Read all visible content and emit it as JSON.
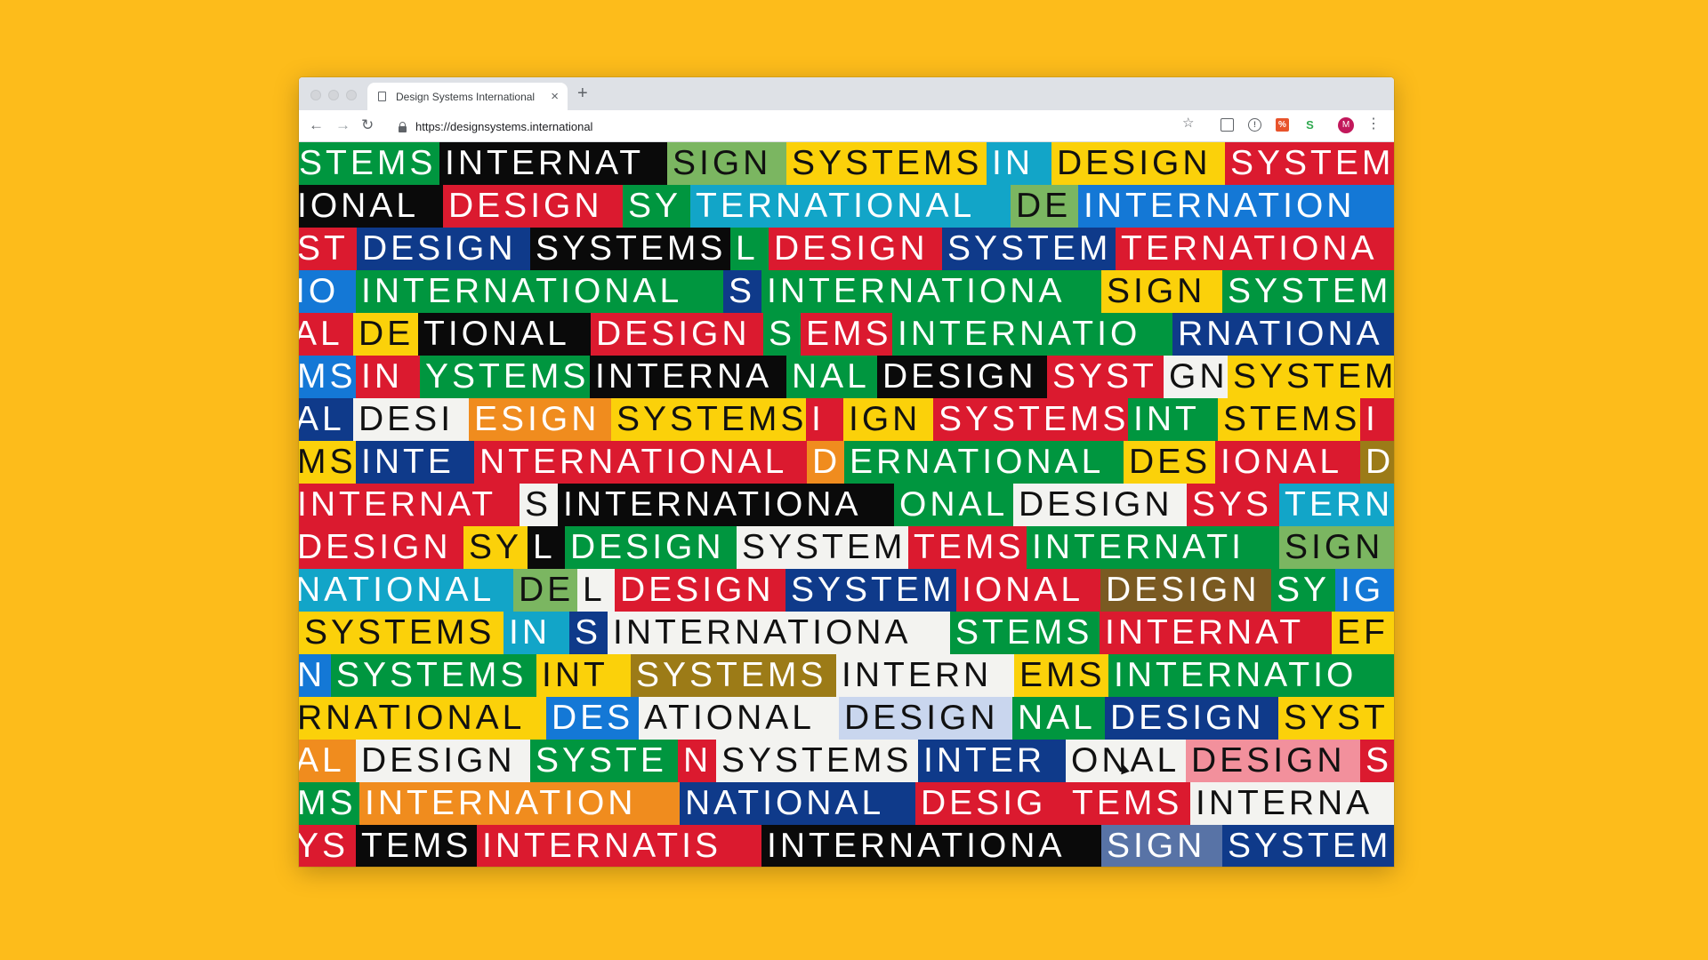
{
  "browser": {
    "tab_title": "Design Systems International",
    "tab_close_glyph": "×",
    "new_tab_glyph": "+",
    "back_glyph": "←",
    "forward_glyph": "→",
    "reload_glyph": "↻",
    "url": "https://designsystems.international",
    "star_glyph": "☆",
    "ext_shield_glyph": "!",
    "ext_pct_glyph": "%",
    "ext_s_glyph": "S",
    "avatar_initial": "M",
    "menu_glyph": "⋮",
    "icons": [
      "page-icon",
      "close-icon",
      "plus-icon",
      "back-arrow-icon",
      "forward-arrow-icon",
      "reload-icon",
      "lock-icon",
      "star-icon",
      "mail-extension-icon",
      "shield-extension-icon",
      "percent-extension-icon",
      "s-extension-icon",
      "avatar",
      "kebab-menu-icon"
    ]
  },
  "colors": {
    "page_background": "#FDBC1B",
    "red": "#DB1A2F",
    "black": "#0A0A0A",
    "lightgreen": "#7BB661",
    "yellow": "#FBD10A",
    "teal": "#12A5C8",
    "navy": "#0F3A8A",
    "green": "#00963F",
    "blue": "#1478D6",
    "white": "#F3F3F0",
    "orange": "#F08C1E",
    "gold": "#9C7B17",
    "brown": "#7A5A22",
    "pink": "#F2909C",
    "lightblue": "#C9D6EE",
    "slate": "#5873A6"
  },
  "content": {
    "rows": [
      [
        {
          "t": "STEMS",
          "c": "green"
        },
        {
          "t": "INTERNAT",
          "c": "black"
        },
        {
          "t": "SIGN",
          "c": "lightgreen"
        },
        {
          "t": "SYSTEMS",
          "c": "yellow"
        },
        {
          "t": "IN",
          "c": "teal"
        },
        {
          "t": "DESIGN",
          "c": "yellow"
        },
        {
          "t": "SYSTEM",
          "c": "red"
        }
      ],
      [
        {
          "t": "IONAL",
          "c": "black"
        },
        {
          "t": "DESIGN",
          "c": "red"
        },
        {
          "t": "SY",
          "c": "green"
        },
        {
          "t": "TERNATIONAL",
          "c": "teal"
        },
        {
          "t": "DE",
          "c": "lightgreen"
        },
        {
          "t": "INTERNATION",
          "c": "blue"
        }
      ],
      [
        {
          "t": "ST",
          "c": "red"
        },
        {
          "t": "DESIGN",
          "c": "navy"
        },
        {
          "t": "SYSTEMS",
          "c": "black"
        },
        {
          "t": "L",
          "c": "green"
        },
        {
          "t": "DESIGN",
          "c": "red"
        },
        {
          "t": "SYSTEM",
          "c": "navy"
        },
        {
          "t": "TERNATIONA",
          "c": "red"
        }
      ],
      [
        {
          "t": "IO",
          "c": "blue"
        },
        {
          "t": "INTERNATIONAL",
          "c": "green"
        },
        {
          "t": "S",
          "c": "navy"
        },
        {
          "t": "INTERNATIONA",
          "c": "green"
        },
        {
          "t": "SIGN",
          "c": "yellow"
        },
        {
          "t": "SYSTEM",
          "c": "green"
        }
      ],
      [
        {
          "t": "AL",
          "c": "red"
        },
        {
          "t": "DE",
          "c": "yellow"
        },
        {
          "t": "TIONAL",
          "c": "black"
        },
        {
          "t": "DESIGN",
          "c": "red"
        },
        {
          "t": "S",
          "c": "green"
        },
        {
          "t": "EMS",
          "c": "red"
        },
        {
          "t": "INTERNATIO",
          "c": "green"
        },
        {
          "t": "RNATIONA",
          "c": "navy"
        }
      ],
      [
        {
          "t": "MS",
          "c": "blue"
        },
        {
          "t": "IN",
          "c": "red"
        },
        {
          "t": "YSTEMS",
          "c": "green"
        },
        {
          "t": "INTERNA",
          "c": "black"
        },
        {
          "t": "NAL",
          "c": "green"
        },
        {
          "t": "DESIGN",
          "c": "black"
        },
        {
          "t": "SYST",
          "c": "red"
        },
        {
          "t": "GN",
          "c": "white"
        },
        {
          "t": "SYSTEM",
          "c": "yellow"
        }
      ],
      [
        {
          "t": "AL",
          "c": "navy"
        },
        {
          "t": "DESI",
          "c": "white"
        },
        {
          "t": "ESIGN",
          "c": "orange"
        },
        {
          "t": "SYSTEMS",
          "c": "yellow"
        },
        {
          "t": "I",
          "c": "red"
        },
        {
          "t": "IGN",
          "c": "yellow"
        },
        {
          "t": "SYSTEMS",
          "c": "red"
        },
        {
          "t": "INT",
          "c": "green"
        },
        {
          "t": "STEMS",
          "c": "yellow"
        },
        {
          "t": "I",
          "c": "red"
        }
      ],
      [
        {
          "t": "MS",
          "c": "yellow"
        },
        {
          "t": "INTE",
          "c": "navy"
        },
        {
          "t": "NTERNATIONAL",
          "c": "red"
        },
        {
          "t": "D",
          "c": "orange"
        },
        {
          "t": "ERNATIONAL",
          "c": "green"
        },
        {
          "t": "DES",
          "c": "yellow"
        },
        {
          "t": "IONAL",
          "c": "red"
        },
        {
          "t": "D",
          "c": "gold"
        }
      ],
      [
        {
          "t": "INTERNAT",
          "c": "red"
        },
        {
          "t": "S",
          "c": "white"
        },
        {
          "t": "INTERNATIONA",
          "c": "black"
        },
        {
          "t": "ONAL",
          "c": "green"
        },
        {
          "t": "DESIGN",
          "c": "white"
        },
        {
          "t": "SYS",
          "c": "red"
        },
        {
          "t": "TERN",
          "c": "teal"
        }
      ],
      [
        {
          "t": "DESIGN",
          "c": "red"
        },
        {
          "t": "SY",
          "c": "yellow"
        },
        {
          "t": "L",
          "c": "black"
        },
        {
          "t": "DESIGN",
          "c": "green"
        },
        {
          "t": "SYSTEM",
          "c": "white"
        },
        {
          "t": "TEMS",
          "c": "red"
        },
        {
          "t": "INTERNATI",
          "c": "green"
        },
        {
          "t": "SIGN",
          "c": "lightgreen"
        }
      ],
      [
        {
          "t": "NATIONAL",
          "c": "teal"
        },
        {
          "t": "DE",
          "c": "lightgreen"
        },
        {
          "t": "L",
          "c": "white"
        },
        {
          "t": "DESIGN",
          "c": "red"
        },
        {
          "t": "SYSTEM",
          "c": "navy"
        },
        {
          "t": "IONAL",
          "c": "red"
        },
        {
          "t": "DESIGN",
          "c": "brown"
        },
        {
          "t": "SY",
          "c": "green"
        },
        {
          "t": "IG",
          "c": "blue"
        }
      ],
      [
        {
          "t": "SYSTEMS",
          "c": "yellow"
        },
        {
          "t": "IN",
          "c": "teal"
        },
        {
          "t": "S",
          "c": "navy"
        },
        {
          "t": "INTERNATIONA",
          "c": "white"
        },
        {
          "t": "STEMS",
          "c": "green"
        },
        {
          "t": "INTERNAT",
          "c": "red"
        },
        {
          "t": "EF",
          "c": "yellow"
        }
      ],
      [
        {
          "t": "N",
          "c": "blue"
        },
        {
          "t": "SYSTEMS",
          "c": "green"
        },
        {
          "t": "INT",
          "c": "yellow"
        },
        {
          "t": "SYSTEMS",
          "c": "gold"
        },
        {
          "t": "INTERN",
          "c": "white"
        },
        {
          "t": "EMS",
          "c": "yellow"
        },
        {
          "t": "INTERNATIO",
          "c": "green"
        }
      ],
      [
        {
          "t": "RNATIONAL",
          "c": "yellow"
        },
        {
          "t": "DES",
          "c": "blue"
        },
        {
          "t": "ATIONAL",
          "c": "white"
        },
        {
          "t": "DESIGN",
          "c": "lightblue"
        },
        {
          "t": "NAL",
          "c": "green"
        },
        {
          "t": "DESIGN",
          "c": "navy"
        },
        {
          "t": "SYST",
          "c": "yellow"
        }
      ],
      [
        {
          "t": "AL",
          "c": "orange"
        },
        {
          "t": "DESIGN",
          "c": "white"
        },
        {
          "t": "SYSTE",
          "c": "green"
        },
        {
          "t": "N",
          "c": "red"
        },
        {
          "t": "SYSTEMS",
          "c": "white"
        },
        {
          "t": "INTER",
          "c": "navy"
        },
        {
          "t": "ONAL",
          "c": "white"
        },
        {
          "t": "DESIGN",
          "c": "pink"
        },
        {
          "t": "S",
          "c": "red"
        }
      ],
      [
        {
          "t": "MS",
          "c": "green"
        },
        {
          "t": "INTERNATION",
          "c": "orange"
        },
        {
          "t": "NATIONAL",
          "c": "navy"
        },
        {
          "t": "DESIG",
          "c": "red"
        },
        {
          "t": "TEMS",
          "c": "red"
        },
        {
          "t": "INTERNA",
          "c": "white"
        }
      ],
      [
        {
          "t": "YS",
          "c": "red"
        },
        {
          "t": "TEMS",
          "c": "black"
        },
        {
          "t": "INTERNATIS",
          "c": "red"
        },
        {
          "t": "INTERNATIONA",
          "c": "black"
        },
        {
          "t": "SIGN",
          "c": "slate"
        },
        {
          "t": "SYSTEM",
          "c": "navy"
        }
      ]
    ]
  }
}
